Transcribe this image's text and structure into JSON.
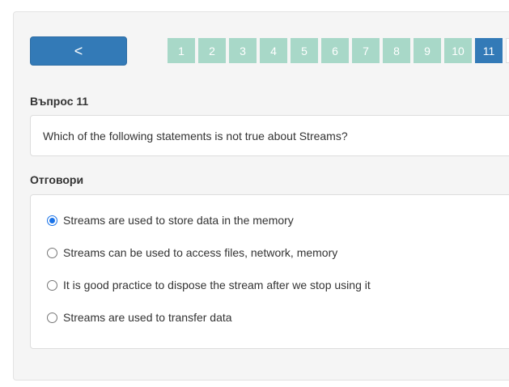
{
  "nav": {
    "back_label": "<",
    "pages": [
      "1",
      "2",
      "3",
      "4",
      "5",
      "6",
      "7",
      "8",
      "9",
      "10",
      "11"
    ],
    "active_page": "11"
  },
  "question": {
    "heading": "Въпрос 11",
    "text": "Which of the following statements is not true about Streams?"
  },
  "answers": {
    "heading": "Отговори",
    "options": [
      "Streams are used to store data in the memory",
      "Streams can be used to access files, network, memory",
      "It is good practice to dispose the stream after we stop using it",
      "Streams are used to transfer data"
    ],
    "selected_index": 0
  },
  "colors": {
    "primary": "#337ab7",
    "page_inactive": "#a8d8c8",
    "radio_checked": "#1a73e8"
  }
}
